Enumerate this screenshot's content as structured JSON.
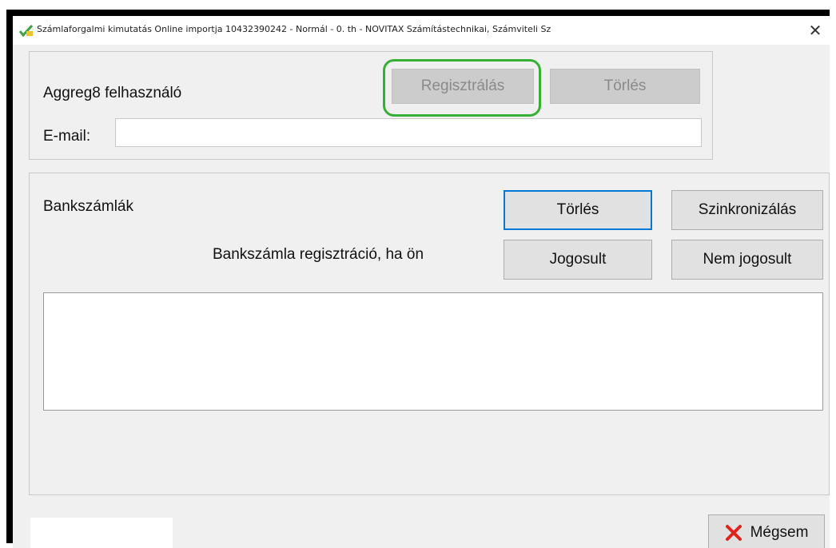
{
  "window": {
    "title": "Számlaforgalmi kimutatás Online importja 10432390242 - Normál - 0. th - NOVITAX Számítástechnikai, Számviteli Sz",
    "close_glyph": "✕",
    "app_icon": "checkmark-leaf-icon"
  },
  "user_group": {
    "title": "Aggreg8 felhasználó",
    "register_label": "Regisztrálás",
    "delete_label": "Törlés",
    "email_label": "E-mail:",
    "email_value": ""
  },
  "bank_group": {
    "title": "Bankszámlák",
    "delete_label": "Törlés",
    "sync_label": "Szinkronizálás",
    "prompt": "Bankszámla regisztráció, ha ön",
    "entitled_label": "Jogosult",
    "not_entitled_label": "Nem jogosult",
    "accounts": []
  },
  "footer": {
    "cancel_label": "Mégsem",
    "cancel_icon": "red-x-icon",
    "status_text": ""
  },
  "colors": {
    "highlight": "#35b035",
    "focus": "#0078d7",
    "cancel_icon": "#e0241b"
  }
}
